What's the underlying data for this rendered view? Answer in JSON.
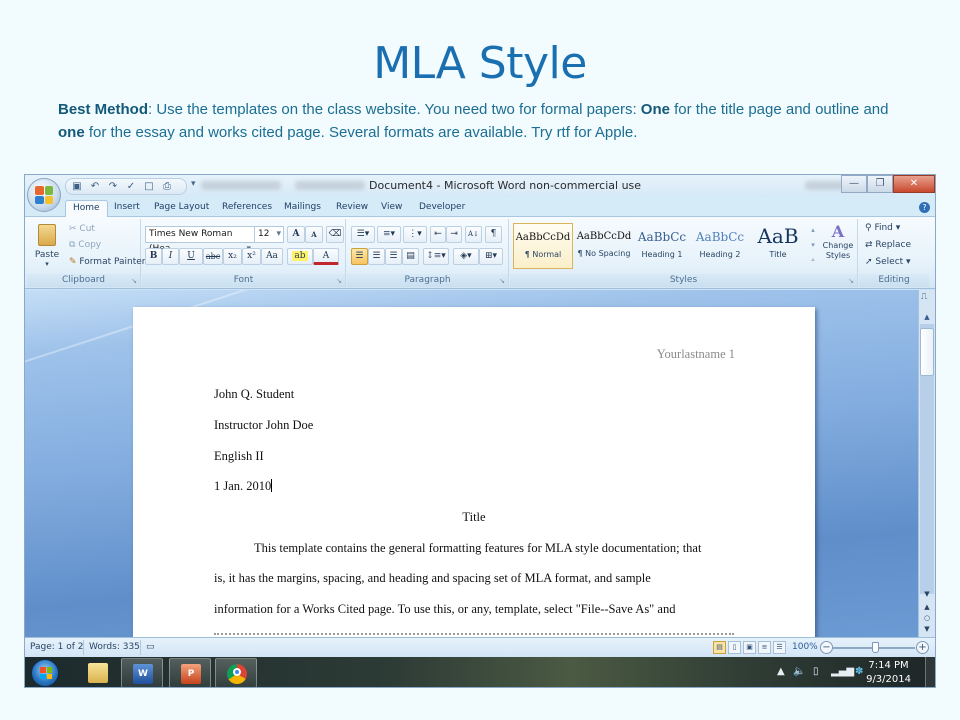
{
  "slide": {
    "title": "MLA Style",
    "para": {
      "bold1": "Best Method",
      "t1": ": Use the templates  on the class website. You need two for formal papers: ",
      "bold2": "One",
      "t2": " for the title page and outline and ",
      "bold3": "one",
      "t3": " for the essay and works cited page.  Several formats are available. Try rtf for Apple."
    }
  },
  "word": {
    "window_title": "Document4 - Microsoft Word non-commercial use",
    "qat": [
      "save-icon",
      "undo-icon",
      "redo-icon",
      "spelling-icon",
      "new-icon",
      "print-icon"
    ],
    "tabs": [
      "Home",
      "Insert",
      "Page Layout",
      "References",
      "Mailings",
      "Review",
      "View",
      "Developer"
    ],
    "active_tab": "Home",
    "clipboard": {
      "label": "Clipboard",
      "paste": "Paste",
      "cut": "Cut",
      "copy": "Copy",
      "format_painter": "Format Painter"
    },
    "font": {
      "label": "Font",
      "font_name": "Times New Roman (Hea",
      "font_size": "12",
      "grow": "A",
      "shrink": "A",
      "bold": "B",
      "italic": "I",
      "underline": "U",
      "strike": "abc",
      "subscript": "x₂",
      "superscript": "x²",
      "change_case": "Aa",
      "font_color": "A"
    },
    "paragraph": {
      "label": "Paragraph",
      "pilcrow": "¶",
      "sort": "A↓"
    },
    "styles": {
      "label": "Styles",
      "items": [
        {
          "sample": "AaBbCcDd",
          "name": "¶ Normal"
        },
        {
          "sample": "AaBbCcDd",
          "name": "¶ No Spacing"
        },
        {
          "sample": "AaBbCc",
          "name": "Heading 1"
        },
        {
          "sample": "AaBbCc",
          "name": "Heading 2"
        },
        {
          "sample": "AaB",
          "name": "Title"
        }
      ],
      "selected": "¶ Normal",
      "change_styles": "Change Styles"
    },
    "editing": {
      "label": "Editing",
      "find": "Find",
      "replace": "Replace",
      "select": "Select"
    },
    "document": {
      "header": "Yourlastname 1",
      "lines": [
        "John Q. Student",
        "Instructor John Doe",
        "English II",
        "1 Jan. 2010"
      ],
      "title": "Title",
      "body": [
        "This template contains the general formatting features for MLA style documentation; that",
        "is, it has the margins, spacing, and heading and spacing set of MLA format, and sample",
        "information for a Works Cited page. To use this, or any, template, select \"File--Save As\" and"
      ]
    },
    "status": {
      "page": "Page: 1 of 2",
      "words": "Words: 335",
      "zoom": "100%",
      "zoom_level_percent": 100
    }
  },
  "taskbar": {
    "apps": [
      "Windows Explorer",
      "Microsoft Word",
      "Microsoft PowerPoint",
      "Google Chrome"
    ],
    "time": "7:14 PM",
    "date": "9/3/2014"
  }
}
